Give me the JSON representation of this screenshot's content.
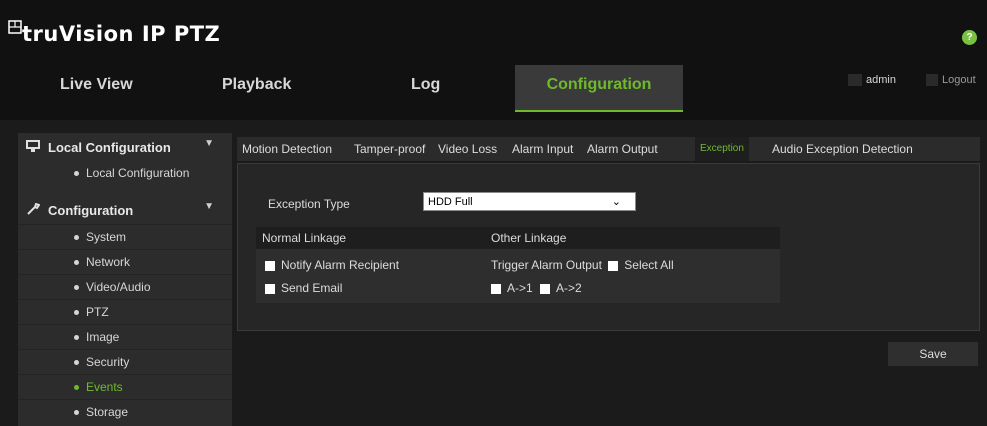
{
  "app": {
    "title": "truVision IP PTZ"
  },
  "nav": {
    "tabs": [
      {
        "label": "Live View",
        "active": false
      },
      {
        "label": "Playback",
        "active": false
      },
      {
        "label": "Log",
        "active": false
      },
      {
        "label": "Configuration",
        "active": true
      }
    ],
    "user": "admin",
    "logout": "Logout"
  },
  "sidebar": {
    "local_header": "Local Configuration",
    "local_items": [
      "Local Configuration"
    ],
    "config_header": "Configuration",
    "config_items": [
      {
        "label": "System",
        "active": false
      },
      {
        "label": "Network",
        "active": false
      },
      {
        "label": "Video/Audio",
        "active": false
      },
      {
        "label": "PTZ",
        "active": false
      },
      {
        "label": "Image",
        "active": false
      },
      {
        "label": "Security",
        "active": false
      },
      {
        "label": "Events",
        "active": true
      },
      {
        "label": "Storage",
        "active": false
      }
    ]
  },
  "subtabs": [
    {
      "label": "Motion Detection",
      "active": false
    },
    {
      "label": "Tamper-proof",
      "active": false
    },
    {
      "label": "Video Loss",
      "active": false
    },
    {
      "label": "Alarm Input",
      "active": false
    },
    {
      "label": "Alarm Output",
      "active": false
    },
    {
      "label": "Exception",
      "active": true
    },
    {
      "label": "Audio Exception Detection",
      "active": false
    }
  ],
  "exception": {
    "type_label": "Exception Type",
    "type_value": "HDD Full"
  },
  "linkage": {
    "normal_header": "Normal Linkage",
    "other_header": "Other Linkage",
    "notify": "Notify Alarm Recipient",
    "email": "Send Email",
    "trigger": "Trigger Alarm Output",
    "select_all": "Select All",
    "outputs": [
      "A->1",
      "A->2"
    ]
  },
  "actions": {
    "save": "Save"
  },
  "colors": {
    "accent": "#6fba2c",
    "help": "#7ac143"
  }
}
